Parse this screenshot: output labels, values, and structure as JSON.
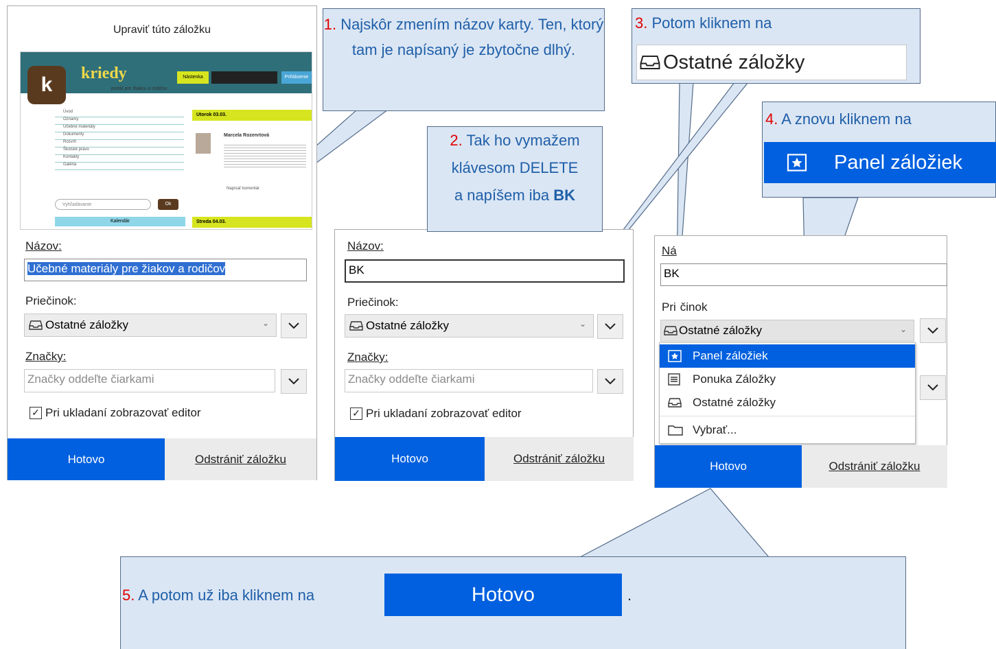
{
  "panel1": {
    "title": "Upraviť túto záložku",
    "name_label": "Názov:",
    "name_value": "Učebné materiály pre žiakov a rodičov",
    "folder_label": "Priečinok:",
    "folder_value": "Ostatné záložky",
    "tags_label": "Značky:",
    "tags_placeholder": "Značky oddeľte čiarkami",
    "show_editor": "Pri ukladaní zobrazovať editor",
    "done": "Hotovo",
    "remove": "Odstrániť záložku",
    "preview": {
      "logo": "k",
      "site": "kriedy",
      "tagline": "portál pre žiakov a rodičov",
      "nav_tab": "Nástenka",
      "user_tab": "Prihlásenie",
      "menu": [
        "Úvod",
        "Oznamy",
        "Učebné materiály",
        "Dokumenty",
        "Rozvrh",
        "Školské právo",
        "Kontakty",
        "Galéria"
      ],
      "search_placeholder": "Vyhľadávanie",
      "search_button": "Ok",
      "post_date_1": "Utorok 03.03.",
      "post_author": "Marcela Rozenrtová",
      "post_date_2": "Streda 04.03.",
      "post_link": "Napísať komentár",
      "calendar": "Kalendár"
    }
  },
  "panel2": {
    "name_label": "Názov:",
    "name_value": "BK",
    "folder_label": "Priečinok:",
    "folder_value": "Ostatné záložky",
    "tags_label": "Značky:",
    "tags_placeholder": "Značky oddeľte čiarkami",
    "show_editor": "Pri ukladaní zobrazovať editor",
    "done": "Hotovo",
    "remove": "Odstrániť záložku"
  },
  "panel3": {
    "name_label": "Ná",
    "name_value": "BK",
    "folder_label_a": "Pri",
    "folder_label_b": "činok",
    "folder_value": "Ostatné záložky",
    "menu": [
      {
        "label": "Panel záložiek",
        "icon": "star-box-icon",
        "selected": true
      },
      {
        "label": "Ponuka Záložky",
        "icon": "menu-list-icon",
        "selected": false
      },
      {
        "label": "Ostatné záložky",
        "icon": "tray-icon",
        "selected": false
      },
      {
        "label": "Vybrať...",
        "icon": "folder-icon",
        "selected": false
      }
    ],
    "done": "Hotovo",
    "remove": "Odstrániť záložku"
  },
  "callouts": {
    "c1": {
      "num": "1.",
      "text": "Najskôr zmením názov karty. Ten, ktorý tam je napísaný je zbytočne dlhý."
    },
    "c2": {
      "num": "2.",
      "line1": "Tak ho vymažem",
      "line2": "klávesom DELETE",
      "line3_pre": "a napíšem iba ",
      "line3_bold": "BK"
    },
    "c3": {
      "num": "3.",
      "text": "Potom kliknem na",
      "button": "Ostatné záložky"
    },
    "c4": {
      "num": "4.",
      "text": "A znovu kliknem na",
      "button": "Panel záložiek"
    },
    "c5": {
      "num": "5.",
      "text": "A potom už iba kliknem na",
      "button": "Hotovo",
      "end": "."
    }
  },
  "colors": {
    "accent": "#0060df",
    "callout_bg": "#dbe6f4",
    "callout_border": "#536b89",
    "callout_text": "#1f5fa8",
    "number": "#e00000"
  }
}
